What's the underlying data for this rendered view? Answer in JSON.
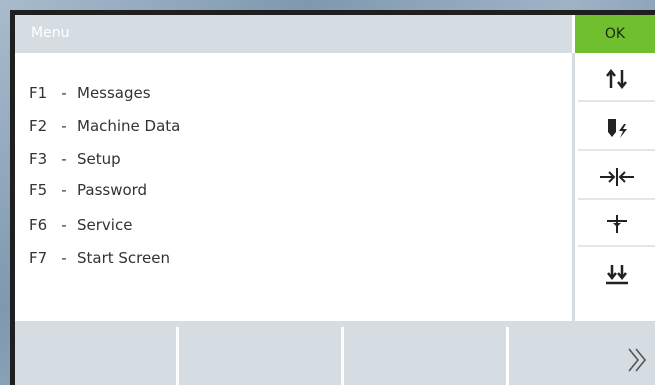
{
  "window": {
    "title": "Menu"
  },
  "ok_button": {
    "label": "OK",
    "color": "#6fbf2e"
  },
  "menu": {
    "items": [
      {
        "key": "F1",
        "sep": "-",
        "label": "Messages"
      },
      {
        "key": "F2",
        "sep": "-",
        "label": "Machine Data"
      },
      {
        "key": "F3",
        "sep": "-",
        "label": "Setup"
      },
      {
        "key": "F5",
        "sep": "-",
        "label": "Password"
      },
      {
        "key": "F6",
        "sep": "-",
        "label": "Service"
      },
      {
        "key": "F7",
        "sep": "-",
        "label": "Start Screen"
      }
    ]
  },
  "side_buttons": [
    {
      "icon": "up-down-arrows-icon"
    },
    {
      "icon": "tool-lightning-icon"
    },
    {
      "icon": "arrows-inward-icon"
    },
    {
      "icon": "needle-icon"
    },
    {
      "icon": "double-down-arrow-icon"
    }
  ],
  "bottom_bar": {
    "next_icon": "double-chevron-right-icon"
  },
  "colors": {
    "title_bg": "#d5dde3",
    "accent": "#6fbf2e"
  }
}
